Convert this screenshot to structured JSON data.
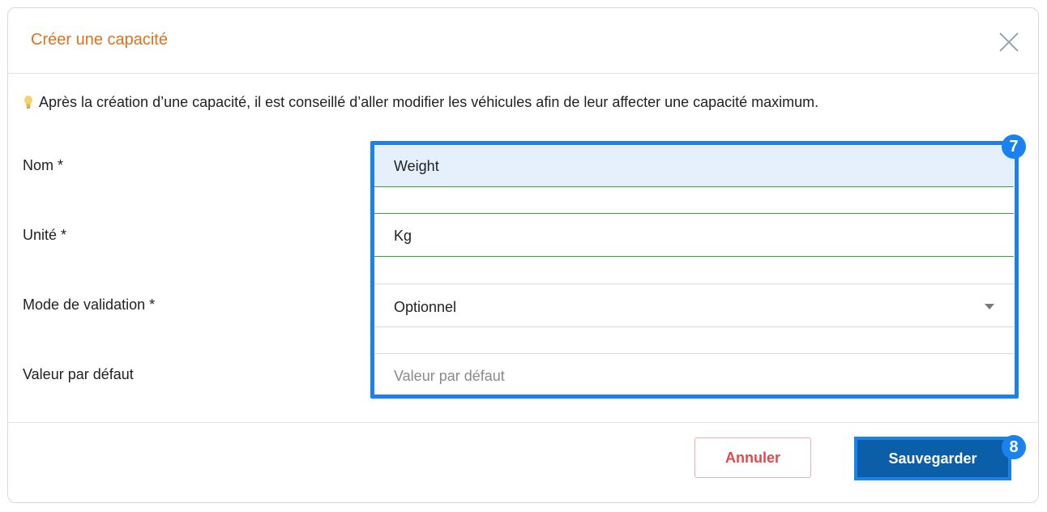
{
  "dialog": {
    "title": "Créer une capacité",
    "hint": "Après la création d’une capacité, il est conseillé d’aller modifier les véhicules afin de leur affecter une capacité maximum."
  },
  "form": {
    "name": {
      "label": "Nom *",
      "value": "Weight"
    },
    "unit": {
      "label": "Unité *",
      "value": "Kg"
    },
    "validation_mode": {
      "label": "Mode de validation *",
      "value": "Optionnel"
    },
    "default_value": {
      "label": "Valeur par défaut",
      "value": "",
      "placeholder": "Valeur par défaut"
    }
  },
  "footer": {
    "cancel_label": "Annuler",
    "save_label": "Sauvegarder"
  },
  "annotations": {
    "fields_step": "7",
    "save_step": "8"
  },
  "colors": {
    "title": "#e0711e",
    "highlight": "#1a82ee",
    "save_button": "#0b5fa8",
    "cancel_text": "#e04a4a",
    "valid_underline": "#3aa33a",
    "focused_input_bg": "#e6f0fc"
  },
  "icons": {
    "close": "close-icon",
    "hint": "lightbulb-icon",
    "select": "caret-down-icon"
  }
}
